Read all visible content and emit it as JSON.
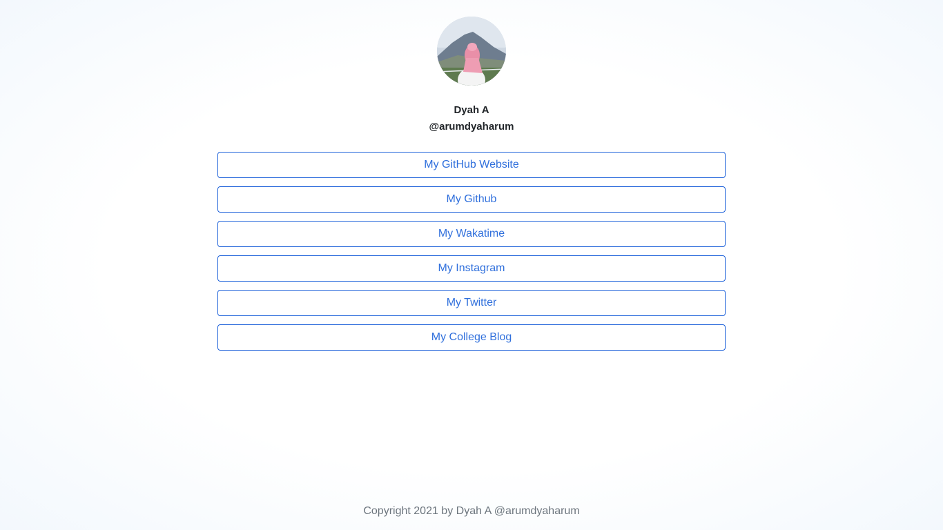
{
  "profile": {
    "name": "Dyah A",
    "handle": "@arumdyaharum"
  },
  "links": [
    {
      "label": "My GitHub Website"
    },
    {
      "label": "My Github"
    },
    {
      "label": "My Wakatime"
    },
    {
      "label": "My Instagram"
    },
    {
      "label": "My Twitter"
    },
    {
      "label": "My College Blog"
    }
  ],
  "footer": {
    "copyright": "Copyright 2021 by Dyah A @arumdyaharum"
  },
  "colors": {
    "accent": "#1a5fd9",
    "link_text": "#2f6fdc",
    "footer_text": "#6c757d"
  }
}
